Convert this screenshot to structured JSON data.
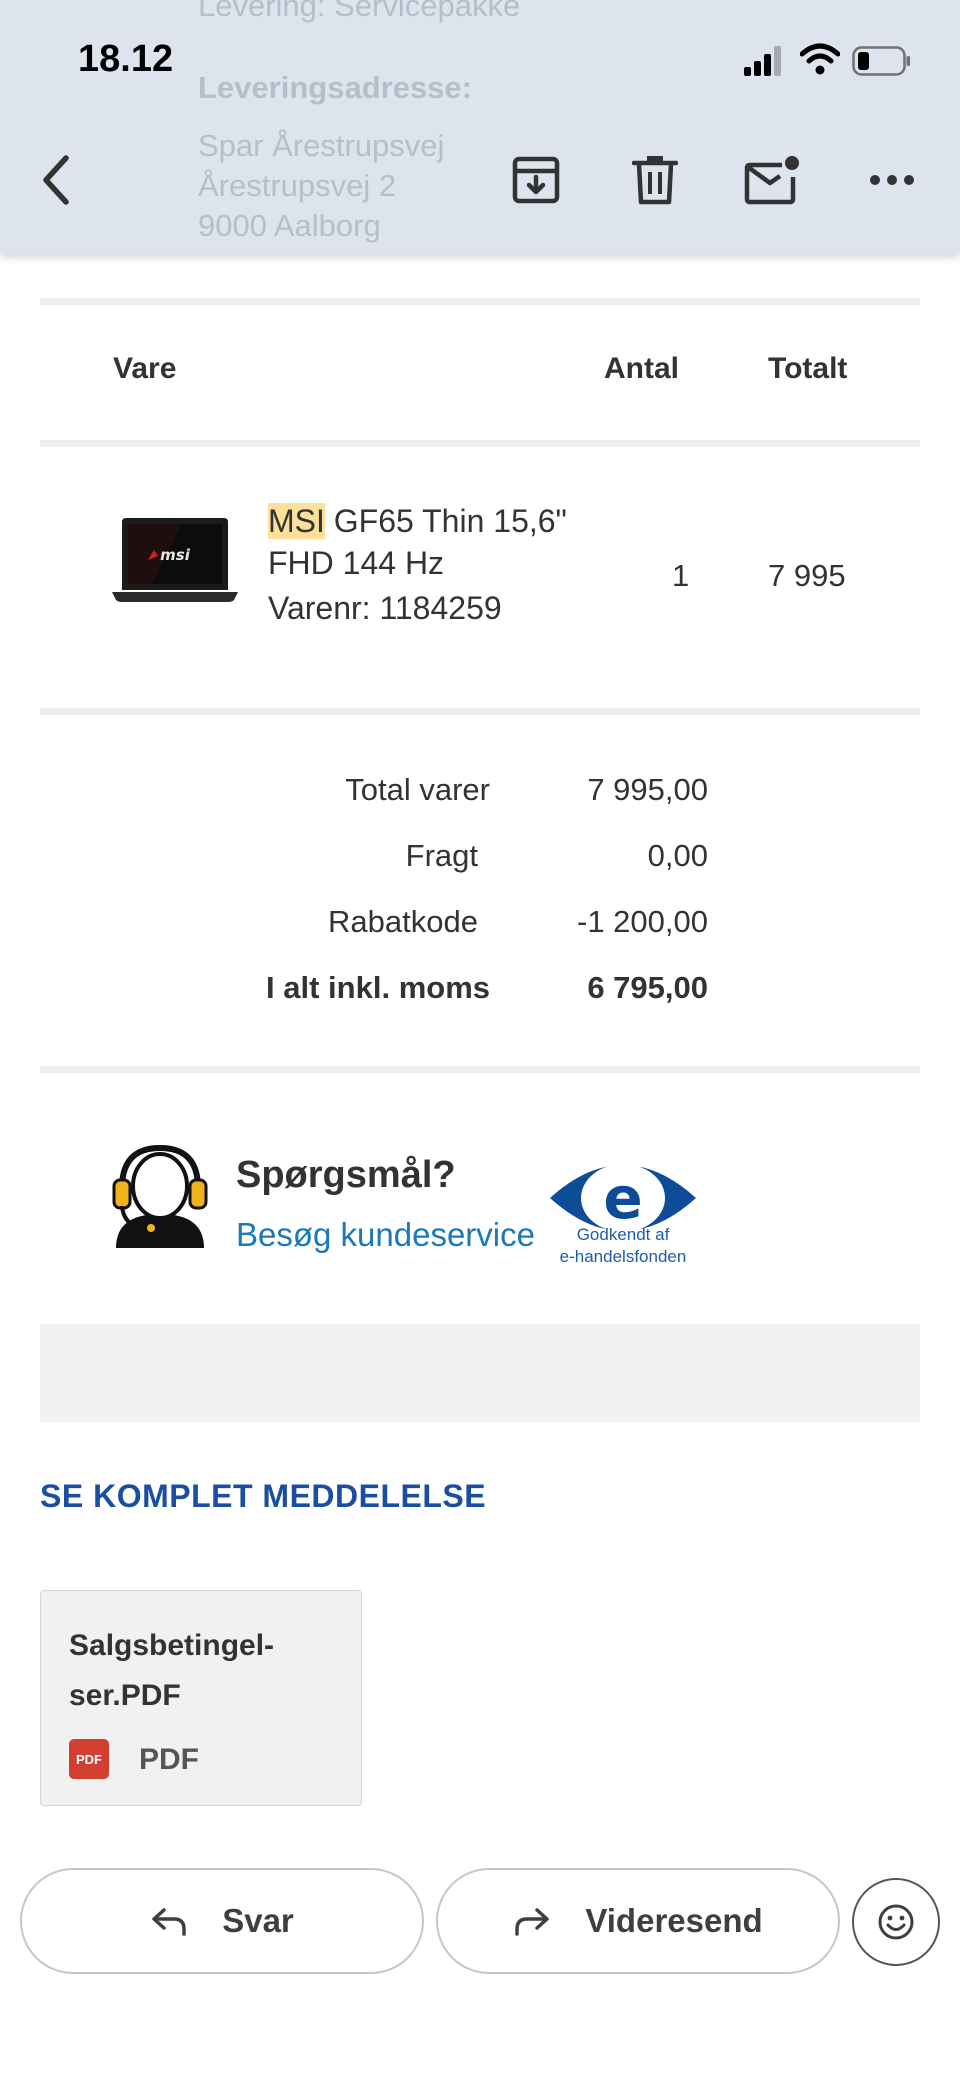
{
  "status_bar": {
    "time": "18.12"
  },
  "background_text": {
    "delivery": "Levering: Servicepakke",
    "address_label": "Leveringsadresse:",
    "address_lines": [
      "Spar Årestrupsvej",
      "Årestrupsvej 2",
      "9000 Aalborg"
    ]
  },
  "toolbar": {
    "back_icon": "chevron-left",
    "archive_icon": "archive-down",
    "delete_icon": "trash",
    "mark_unread_icon": "mail-with-dot",
    "more_icon": "ellipsis"
  },
  "order_table": {
    "headers": {
      "item": "Vare",
      "quantity": "Antal",
      "total": "Totalt"
    },
    "items": [
      {
        "brand": "MSI",
        "name_rest": " GF65 Thin 15,6\" FHD 144 Hz",
        "sku": "Varenr: 1184259",
        "quantity": "1",
        "total": "7 995"
      }
    ]
  },
  "summary": {
    "rows": [
      {
        "label": "Total varer",
        "value": "7 995,00"
      },
      {
        "label": "Fragt",
        "value": "0,00"
      },
      {
        "label": "Rabatkode",
        "value": "-1 200,00"
      },
      {
        "label": "I alt inkl. moms",
        "value": "6 795,00"
      }
    ]
  },
  "support": {
    "title": "Spørgsmål?",
    "link": "Besøg kundeservice",
    "badge_text_1": "Godkendt af",
    "badge_text_2": "e-handelsfonden"
  },
  "see_full_message": "SE KOMPLET MEDDELELSE",
  "attachment": {
    "filename": "Salgsbetingel-ser.PDF",
    "icon_label": "PDF",
    "type": "PDF"
  },
  "actions": {
    "reply": "Svar",
    "forward": "Videresend",
    "emoji_icon": "smiley"
  },
  "colors": {
    "toolbar_bg": "#dde4ee",
    "link_blue": "#1c78b7",
    "accent_blue": "#1a4fa0",
    "highlight": "#fbdf9a",
    "pdf_red": "#d23f31"
  }
}
